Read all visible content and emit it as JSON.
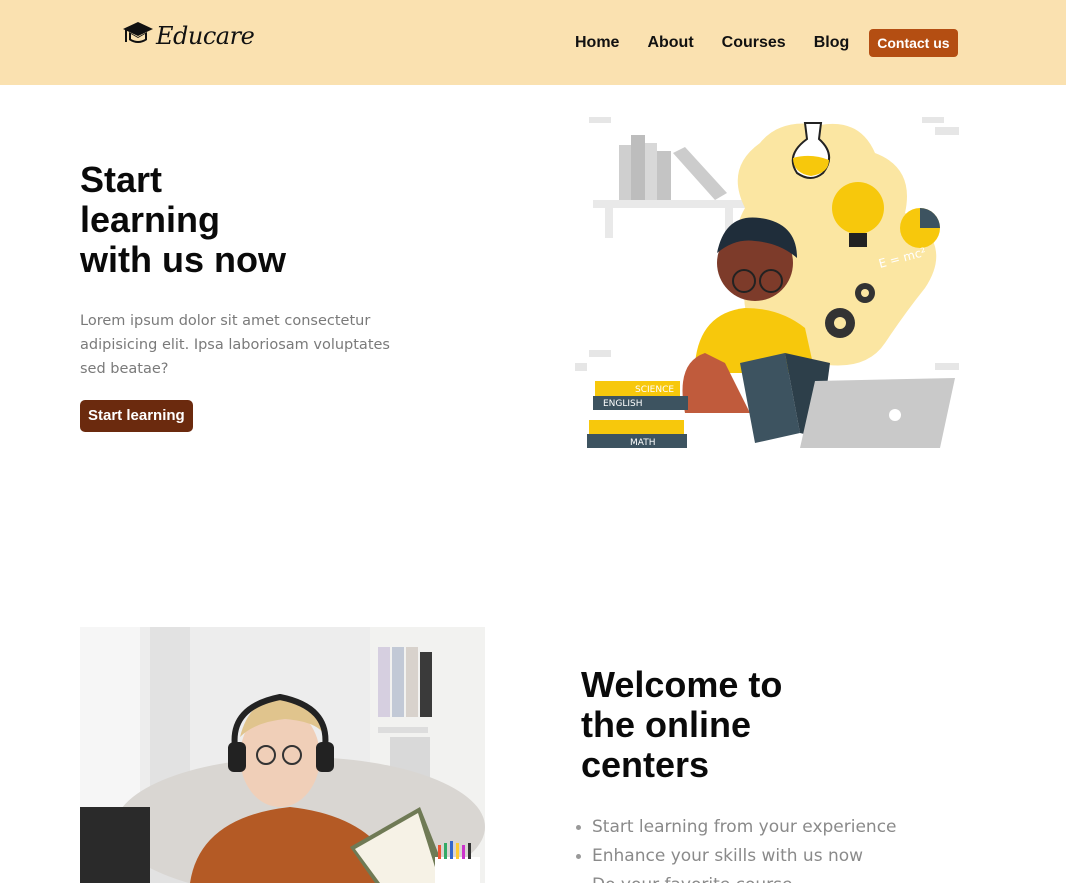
{
  "brand": {
    "name": "Educare",
    "icon": "graduation-cap-icon"
  },
  "nav": {
    "items": [
      {
        "label": "Home"
      },
      {
        "label": "About"
      },
      {
        "label": "Courses"
      },
      {
        "label": "Blog"
      }
    ],
    "contact_label": "Contact us"
  },
  "hero": {
    "title_line1": "Start",
    "title_line2": "learning",
    "title_line3": "with us now",
    "description": "Lorem ipsum dolor sit amet consectetur adipisicing elit. Ipsa laboriosam voluptates sed beatae?",
    "button_label": "Start learning",
    "illustration": {
      "book_labels": [
        "SCIENCE",
        "ENGLISH",
        "MATH"
      ],
      "formula": "E = mc²"
    }
  },
  "welcome": {
    "title_line1": "Welcome to",
    "title_line2": "the online",
    "title_line3": "centers",
    "features": [
      "Start learning from your experience",
      "Enhance your skills with us now",
      "Do your favorite course"
    ]
  },
  "colors": {
    "navbar_bg": "#fae1b0",
    "contact_button": "#b44e12",
    "hero_button": "#6b2a0e",
    "accent_yellow": "#f7c80c",
    "text_muted": "#7a7a7a"
  }
}
